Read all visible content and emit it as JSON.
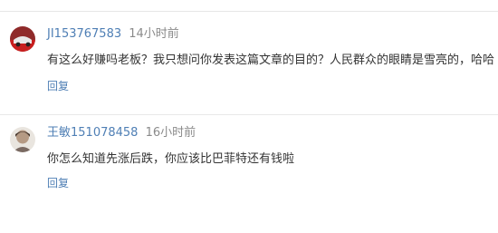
{
  "comments": [
    {
      "username": "JI153767583",
      "time": "14小时前",
      "text": "有这么好赚吗老板？我只想问你发表这篇文章的目的？人民群众的眼睛是雪亮的，哈哈",
      "reply_label": "回复"
    },
    {
      "username": "王敏151078458",
      "time": "16小时前",
      "text": "你怎么知道先涨后跌，你应该比巴菲特还有钱啦",
      "reply_label": "回复"
    }
  ],
  "colors": {
    "username": "#4f7fb5",
    "reply": "#4f7fb5",
    "time": "#8a8a8a",
    "text": "#333333"
  }
}
